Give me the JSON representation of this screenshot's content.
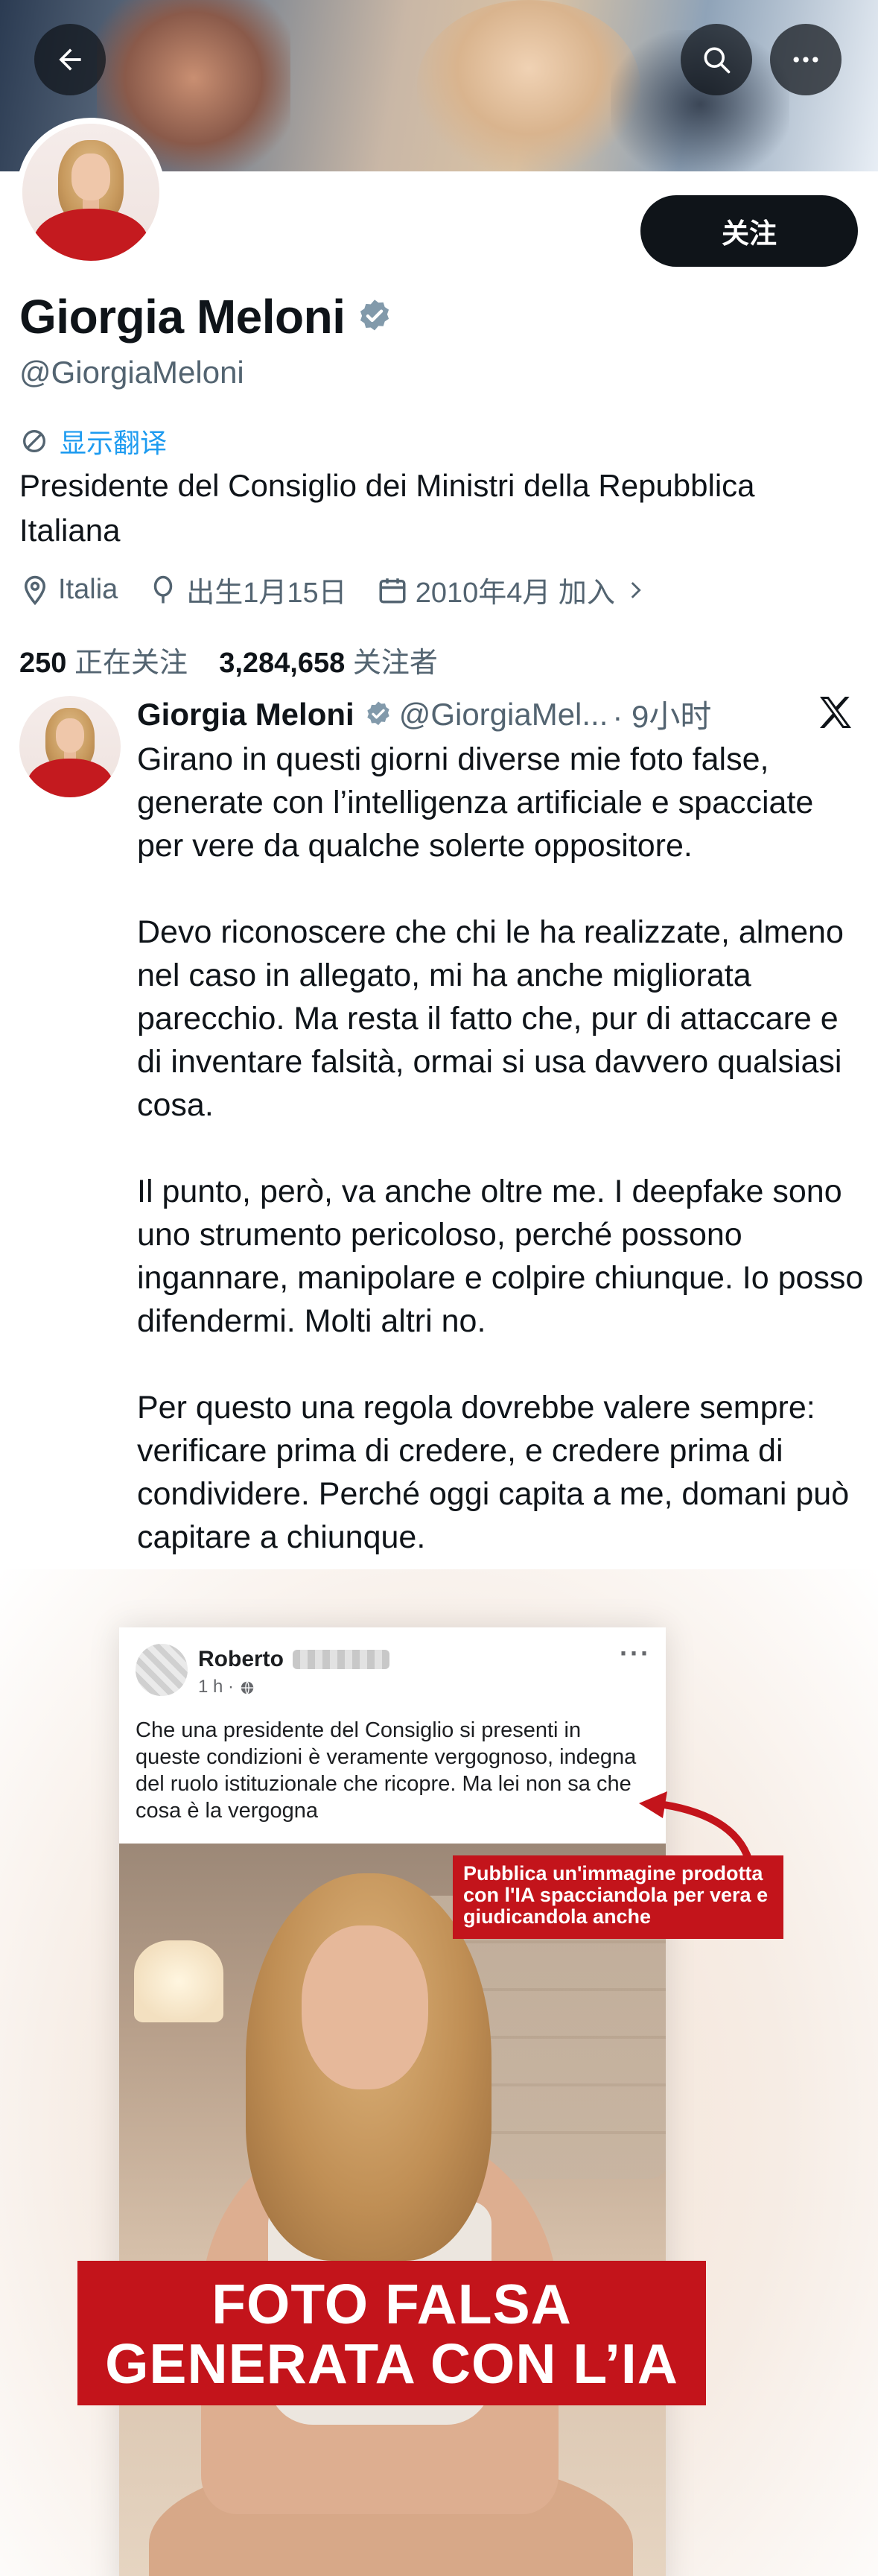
{
  "header": {
    "back_icon": "arrow-left-icon",
    "search_icon": "search-icon",
    "more_icon": "more-horizontal-icon"
  },
  "profile": {
    "follow_label": "关注",
    "name": "Giorgia Meloni",
    "handle": "@GiorgiaMeloni",
    "translate_label": "显示翻译",
    "bio": "Presidente del Consiglio dei Ministri della Repubblica Italiana",
    "location": "Italia",
    "birthday": "出生1月15日",
    "joined": "2010年4月 加入",
    "following_count": "250",
    "following_label": "正在关注",
    "followers_count": "3,284,658",
    "followers_label": "关注者",
    "verified_color": "#829aab"
  },
  "tweet": {
    "author": "Giorgia Meloni",
    "handle": "@GiorgiaMel...",
    "time": "· 9小时",
    "paragraphs": [
      "Girano in questi giorni diverse mie foto false, generate con l’intelligenza artificiale e spacciate per vere da qualche solerte oppositore.",
      "Devo riconoscere che chi le ha realizzate, almeno nel caso in allegato, mi ha anche migliorata parecchio. Ma resta il fatto che, pur di attaccare e di inventare falsità, ormai si usa davvero qualsiasi cosa.",
      "Il punto, però, va anche oltre me. I deepfake sono uno strumento pericoloso, perché possono ingannare, manipolare e colpire chiunque. Io posso difendermi. Molti altri no.",
      "Per questo una regola dovrebbe valere sempre: verificare prima di credere, e credere prima di condividere. Perché oggi capita a me, domani può capitare a chiunque."
    ]
  },
  "media": {
    "fb_name": "Roberto",
    "fb_time": "1 h ·",
    "fb_text": "Che una presidente del Consiglio  si presenti in queste condizioni è veramente vergognoso, indegna del ruolo istituzionale che ricopre. Ma lei non sa che cosa è la vergogna",
    "note": "Pubblica un'immagine prodotta con l'IA spacciandola per vera e giudicandola anche",
    "banner_line1": "FOTO FALSA",
    "banner_line2": "GENERATA CON L’IA",
    "accent_red": "#c3141b"
  }
}
